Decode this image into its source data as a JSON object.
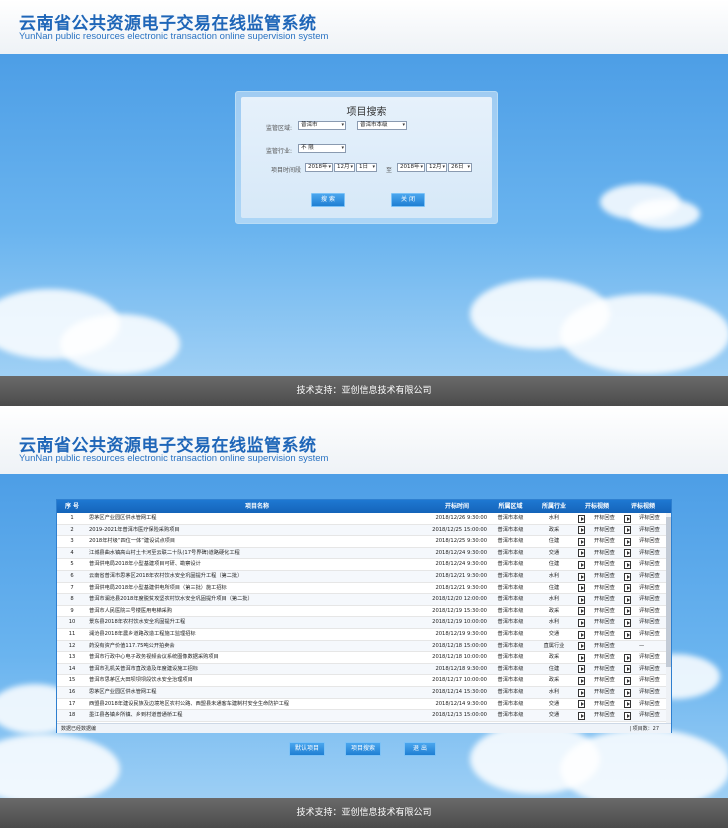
{
  "brand": {
    "title_cn": "云南省公共资源电子交易在线监管系统",
    "title_en": "YunNan public resources electronic transaction online supervision system"
  },
  "footer": {
    "text": "技术支持：亚创信息技术有限公司"
  },
  "search": {
    "title": "项目搜索",
    "region_label": "监管区域:",
    "region_city": "普洱市",
    "region_district": "普洱市本级",
    "industry_label": "监管行业:",
    "industry_value": "不 限",
    "time_label": "项目时间段",
    "to_label": "至",
    "start_year": "2018年",
    "start_month": "12月",
    "start_day": "1日",
    "end_year": "2018年",
    "end_month": "12月",
    "end_day": "26日",
    "search_button": "搜 索",
    "close_button": "关 闭"
  },
  "table": {
    "headers": [
      "序 号",
      "项目名称",
      "开标时间",
      "所属区域",
      "所属行业",
      "开标视频",
      "评标视频"
    ],
    "rows": [
      {
        "no": "1",
        "name": "思茅区产业园区供水管网工程",
        "time": "2018/12/26 9:30:00",
        "region": "普洱市本级",
        "industry": "水利",
        "open": "开标回查",
        "eval": "评标回查"
      },
      {
        "no": "2",
        "name": "2019-2021年普洱市医疗保险采购项目",
        "time": "2018/12/25 15:00:00",
        "region": "普洱市本级",
        "industry": "政采",
        "open": "开标回查",
        "eval": "评标回查"
      },
      {
        "no": "3",
        "name": "2018年村级“四位一体”建设试点项目",
        "time": "2018/12/25 9:30:00",
        "region": "普洱市本级",
        "industry": "住建",
        "open": "开标回查",
        "eval": "评标回查"
      },
      {
        "no": "4",
        "name": "江城县曲水镇高山村土卡河至云联二十队(17号界碑)道路硬化工程",
        "time": "2018/12/24 9:30:00",
        "region": "普洱市本级",
        "industry": "交通",
        "open": "开标回查",
        "eval": "评标回查"
      },
      {
        "no": "5",
        "name": "普洱供电局2018年小型基建项目可研、勘察设计",
        "time": "2018/12/24 9:30:00",
        "region": "普洱市本级",
        "industry": "住建",
        "open": "开标回查",
        "eval": "评标回查"
      },
      {
        "no": "6",
        "name": "云南省普洱市思茅区2018年农村饮水安全巩固提升工程（第二批）",
        "time": "2018/12/21 9:30:00",
        "region": "普洱市本级",
        "industry": "水利",
        "open": "开标回查",
        "eval": "评标回查"
      },
      {
        "no": "7",
        "name": "普洱供电局2018年小型基建供电所项目（第三批）施工招标",
        "time": "2018/12/21 9:30:00",
        "region": "普洱市本级",
        "industry": "住建",
        "open": "开标回查",
        "eval": "评标回查"
      },
      {
        "no": "8",
        "name": "普洱市澜沧县2018年度脱贫攻坚农村饮水安全巩固提升项目（第二批）",
        "time": "2018/12/20 12:00:00",
        "region": "普洱市本级",
        "industry": "水利",
        "open": "开标回查",
        "eval": "评标回查"
      },
      {
        "no": "9",
        "name": "普洱市人民医院三号楼医用电梯采购",
        "time": "2018/12/19 15:30:00",
        "region": "普洱市本级",
        "industry": "政采",
        "open": "开标回查",
        "eval": "评标回查"
      },
      {
        "no": "10",
        "name": "景东县2018年农村饮水安全巩固提升工程",
        "time": "2018/12/19 10:00:00",
        "region": "普洱市本级",
        "industry": "水利",
        "open": "开标回查",
        "eval": "评标回查"
      },
      {
        "no": "11",
        "name": "澜沧县2018年農乡道路改造工程施工监理招标",
        "time": "2018/12/19 9:30:00",
        "region": "普洱市本级",
        "industry": "交通",
        "open": "开标回查",
        "eval": "评标回查"
      },
      {
        "no": "12",
        "name": "药没有资产价值117.75吨公开拍卖会",
        "time": "2018/12/18 15:00:00",
        "region": "普洱市本级",
        "industry": "直属行业",
        "open": "开标回查",
        "eval": "—"
      },
      {
        "no": "13",
        "name": "普洱市行政中心电子政务视频会议系统图像数据采购项目",
        "time": "2018/12/18 10:00:00",
        "region": "普洱市本级",
        "industry": "政采",
        "open": "开标回查",
        "eval": "评标回查"
      },
      {
        "no": "14",
        "name": "普洱市孔机关普洱市直改造及年度建设施工招标",
        "time": "2018/12/18 9:30:00",
        "region": "普洱市本级",
        "industry": "住建",
        "open": "开标回查",
        "eval": "评标回查"
      },
      {
        "no": "15",
        "name": "普洱市思茅区大田坝坝坝段饮水安全治理项目",
        "time": "2018/12/17 10:00:00",
        "region": "普洱市本级",
        "industry": "政采",
        "open": "开标回查",
        "eval": "评标回查"
      },
      {
        "no": "16",
        "name": "思茅区产业园区供水管网工程",
        "time": "2018/12/14 15:30:00",
        "region": "普洱市本级",
        "industry": "水利",
        "open": "开标回查",
        "eval": "评标回查"
      },
      {
        "no": "17",
        "name": "西盟县2018年建设民族及边境地区农村公路、西盟县未通客车建制村安全生命防护工程",
        "time": "2018/12/14 9:30:00",
        "region": "普洱市本级",
        "industry": "交通",
        "open": "开标回查",
        "eval": "评标回查"
      },
      {
        "no": "18",
        "name": "墨江县各镇乡所镇、乡到村道普通桥工程",
        "time": "2018/12/13 15:00:00",
        "region": "普洱市本级",
        "industry": "交通",
        "open": "开标回查",
        "eval": "评标回查"
      }
    ],
    "status_left": "数据已经数据编",
    "status_right": "| 项目数：27"
  },
  "actions": {
    "default_button": "默认项目",
    "search_button": "项目搜索",
    "exit_button": "退 出"
  }
}
